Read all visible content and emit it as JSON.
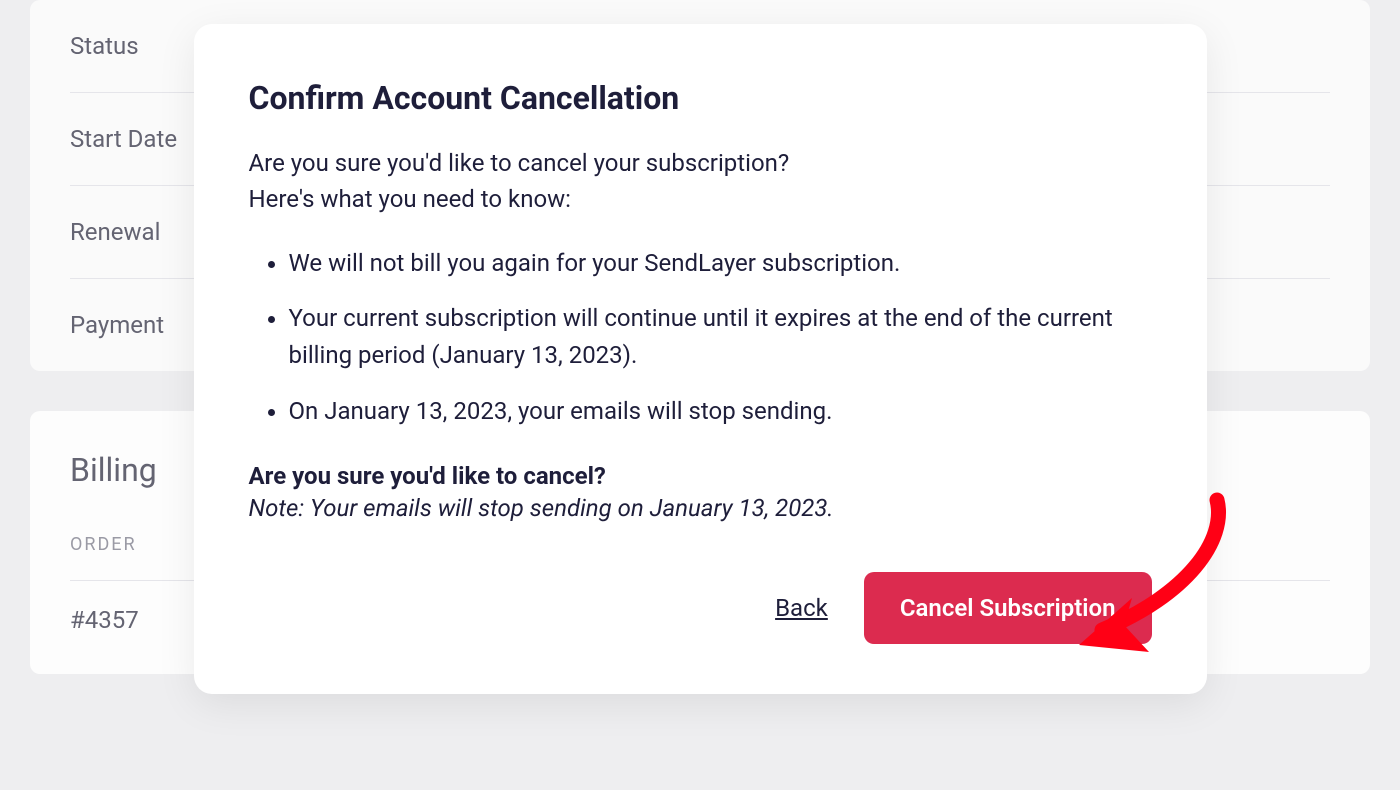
{
  "background": {
    "rows": [
      "Status",
      "Start Date",
      "Renewal",
      "Payment"
    ],
    "billing_title": "Billing",
    "order_header": "ORDER",
    "order_number": "#4357"
  },
  "modal": {
    "title": "Confirm Account Cancellation",
    "intro_line1": "Are you sure you'd like to cancel your subscription?",
    "intro_line2": "Here's what you need to know:",
    "bullets": [
      "We will not bill you again for your SendLayer subscription.",
      "Your current subscription will continue until it expires at the end of the current billing period (January 13, 2023).",
      "On January 13, 2023, your emails will stop sending."
    ],
    "confirm_question": "Are you sure you'd like to cancel?",
    "note": "Note: Your emails will stop sending on January 13, 2023.",
    "back_label": "Back",
    "cancel_label": "Cancel Subscription"
  }
}
